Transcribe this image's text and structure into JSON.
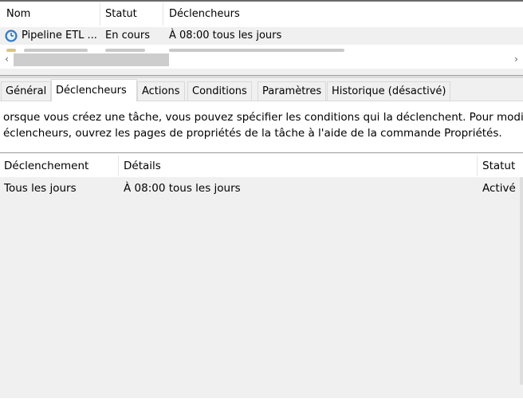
{
  "task_list": {
    "columns": [
      "Nom",
      "Statut",
      "Déclencheurs"
    ],
    "rows": [
      {
        "name": "Pipeline ETL ...",
        "status": "En cours",
        "triggers": "À 08:00 tous les jours",
        "icon": "clock-icon"
      }
    ]
  },
  "scrollbar": {
    "left_arrow": "‹",
    "right_arrow": "›"
  },
  "tabs": [
    {
      "label": "Général"
    },
    {
      "label": "Déclencheurs",
      "active": true
    },
    {
      "label": "Actions"
    },
    {
      "label": "Conditions"
    },
    {
      "label": "Paramètres"
    },
    {
      "label": "Historique (désactivé)"
    }
  ],
  "description": {
    "line1": "orsque vous créez une tâche, vous pouvez spécifier les conditions qui la déclenchent. Pour modifie",
    "line2": "éclencheurs, ouvrez les pages de propriétés de la tâche à l'aide de la commande Propriétés."
  },
  "triggers_grid": {
    "columns": [
      "Déclenchement",
      "Détails",
      "Statut"
    ],
    "rows": [
      {
        "trigger": "Tous les jours",
        "details": "À 08:00 tous les jours",
        "status": "Activé"
      }
    ]
  },
  "colors": {
    "clock_blue": "#3c8ad8",
    "selected_row": "#f0f0f0"
  }
}
